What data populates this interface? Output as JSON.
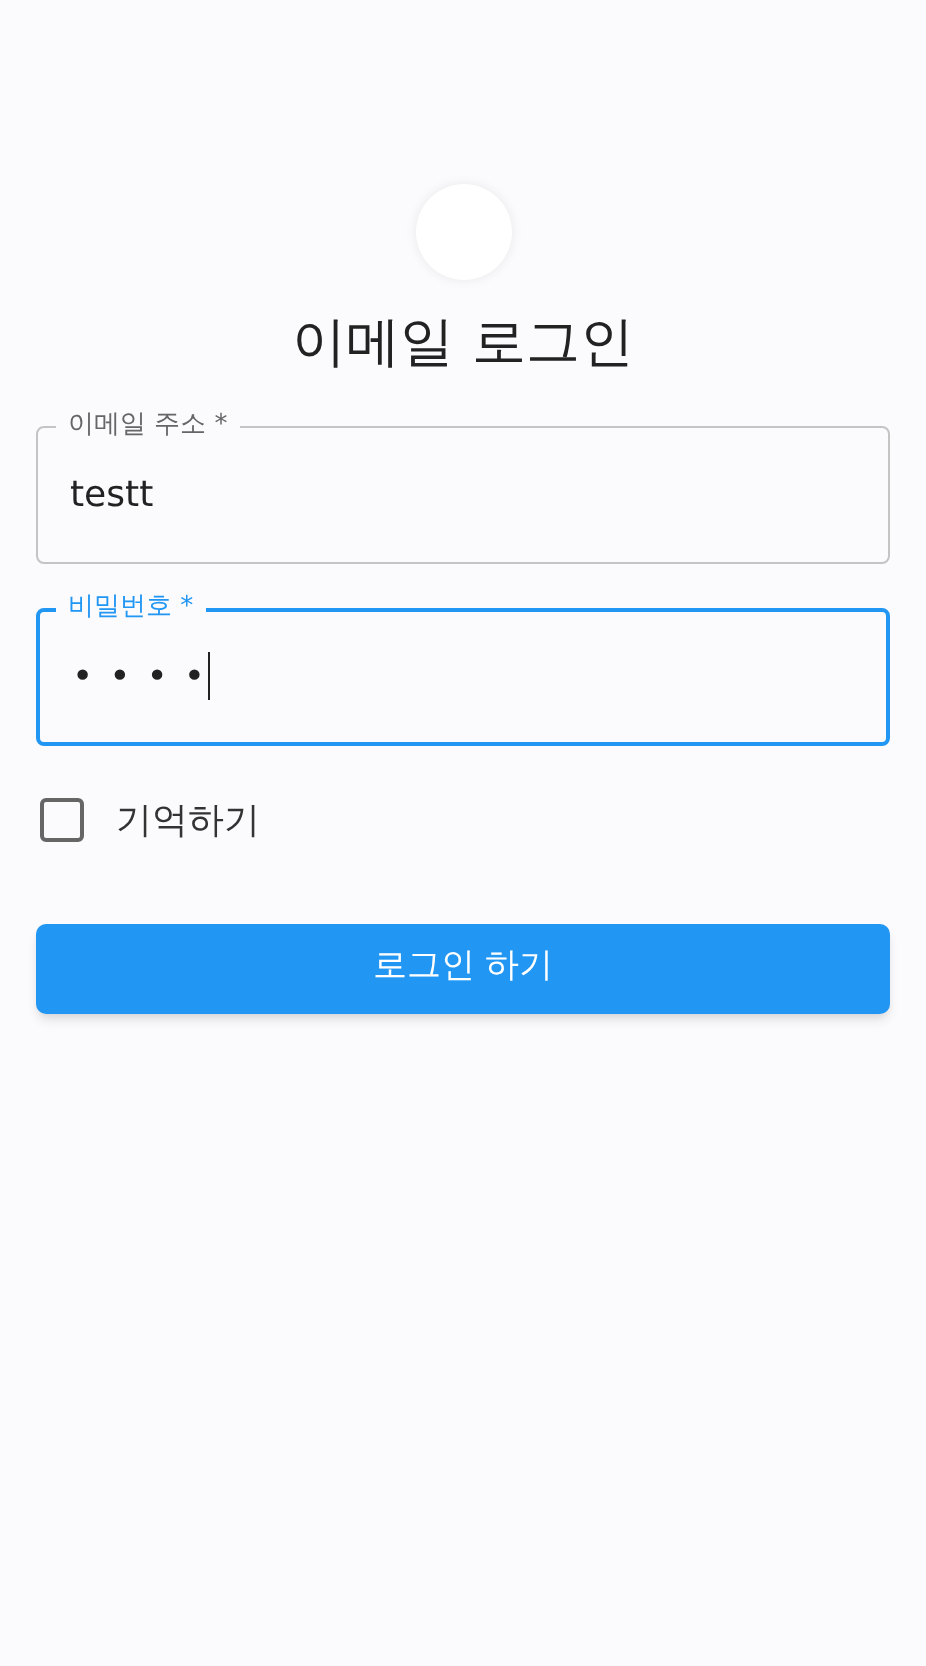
{
  "title": "이메일 로그인",
  "fields": [
    {
      "label": "이메일 주소",
      "required_mark": "*",
      "value": "testt",
      "focused": false
    },
    {
      "label": "비밀번호",
      "required_mark": "*",
      "value": "••••",
      "focused": true
    }
  ],
  "remember": {
    "label": "기억하기",
    "checked": false
  },
  "submit": {
    "label": "로그인 하기"
  }
}
